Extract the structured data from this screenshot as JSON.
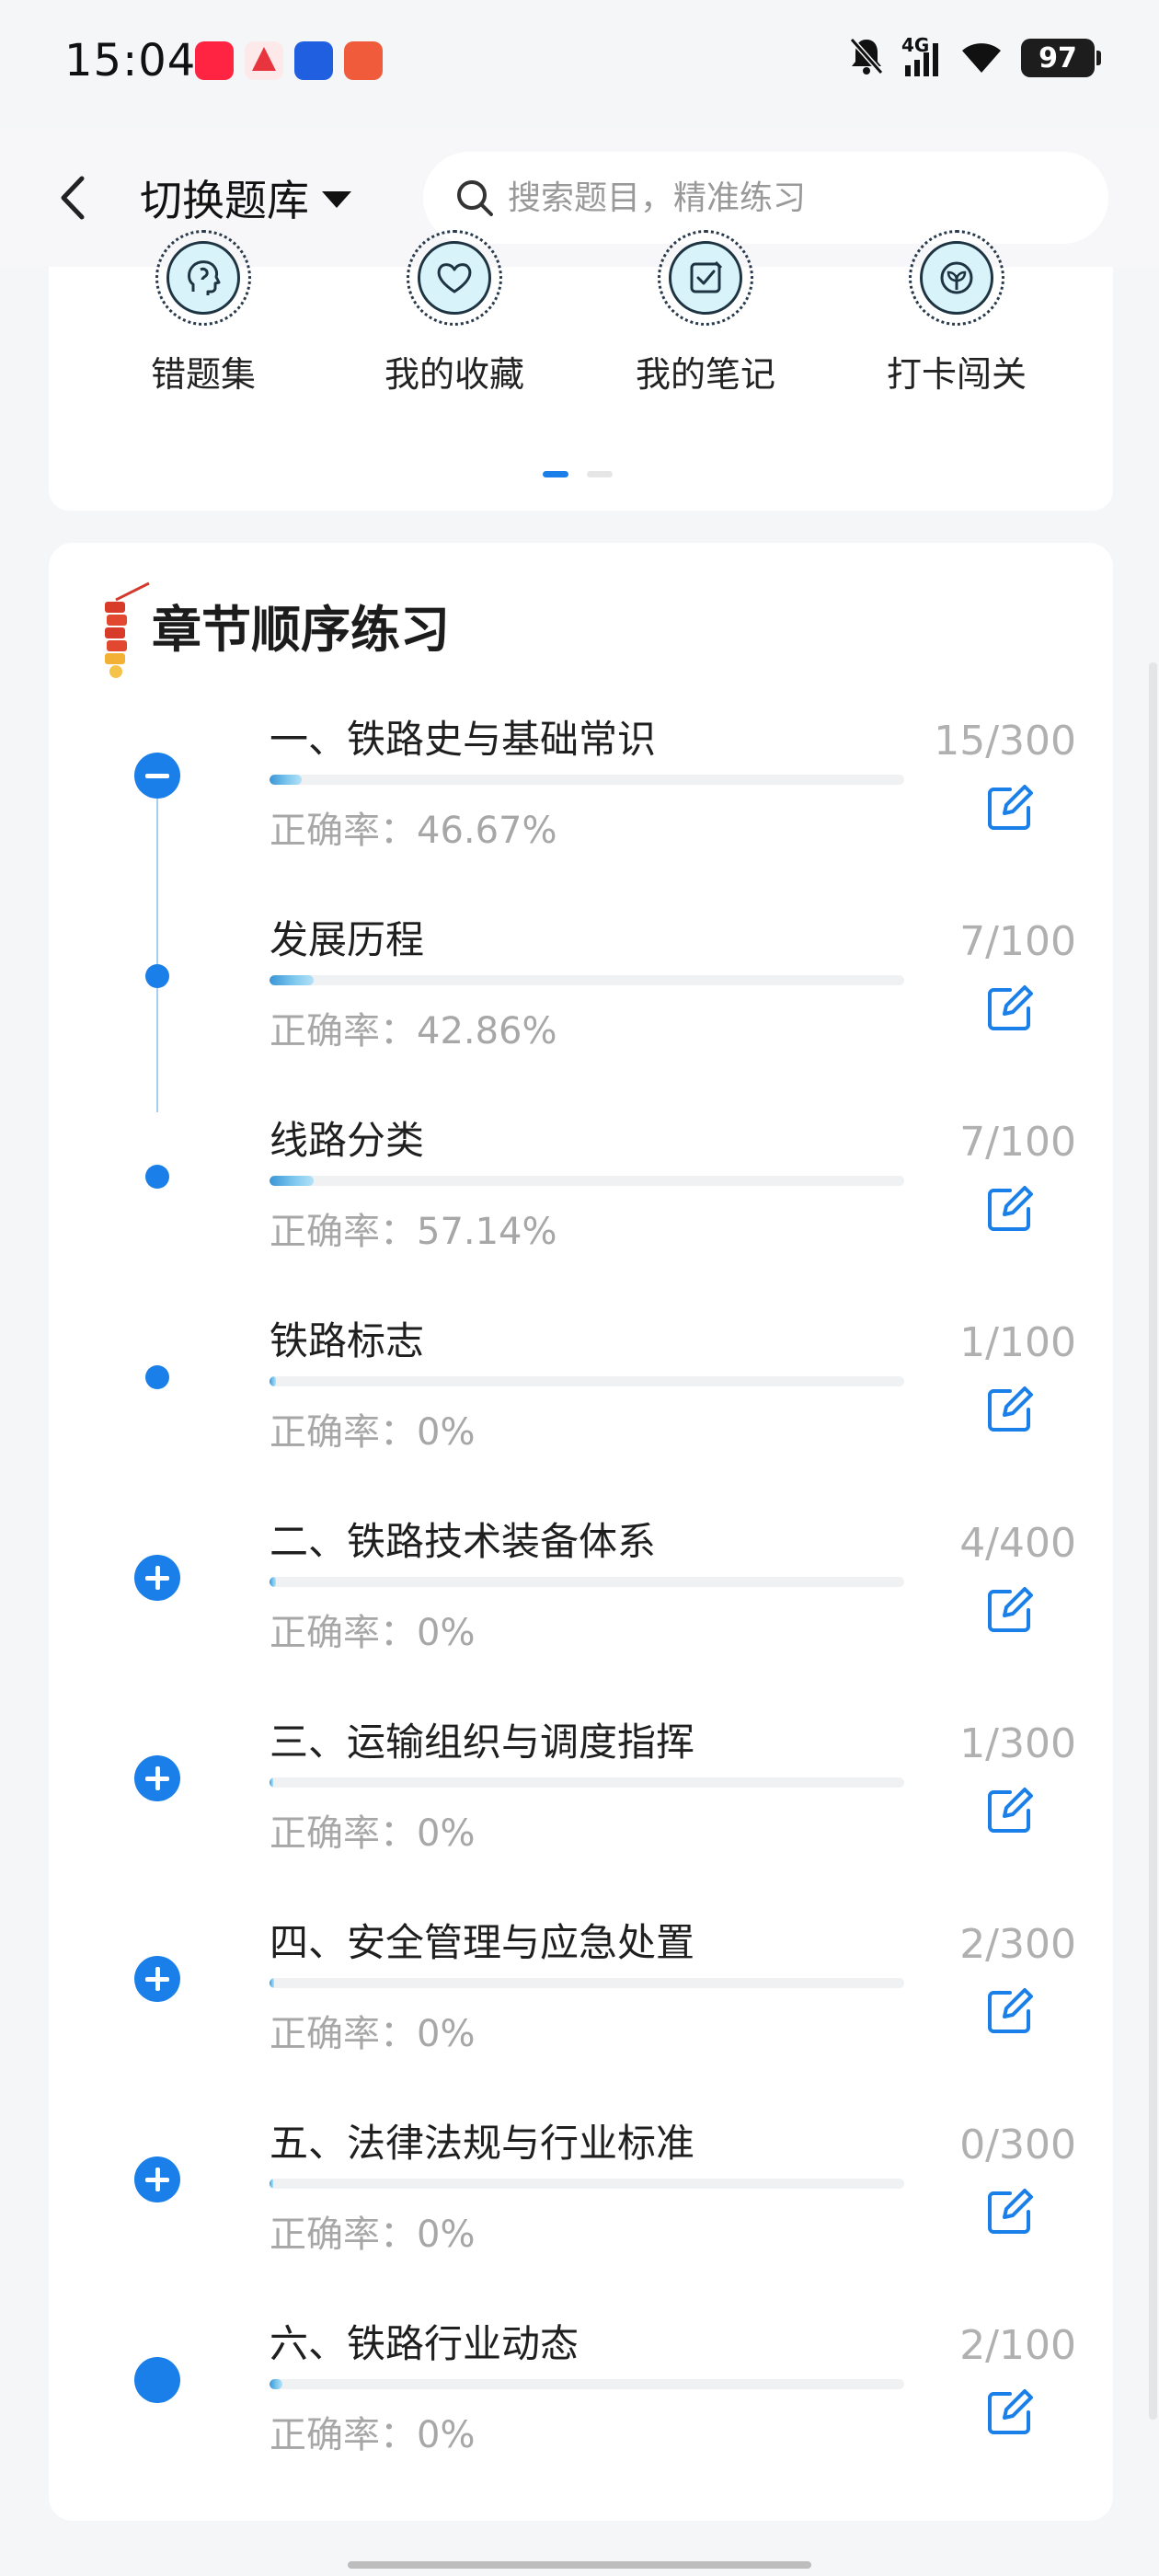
{
  "status_bar": {
    "time": "15:04",
    "network": "4G",
    "battery": "97",
    "app_icons": [
      "xiaohongshu-icon",
      "app-a-icon",
      "app-b-icon",
      "app-c-icon"
    ]
  },
  "header": {
    "switch_bank_label": "切换题库",
    "search_placeholder": "搜索题目，精准练习"
  },
  "quick_actions": [
    {
      "label": "错题集",
      "icon": "head-icon"
    },
    {
      "label": "我的收藏",
      "icon": "heart-icon"
    },
    {
      "label": "我的笔记",
      "icon": "note-check-icon"
    },
    {
      "label": "打卡闯关",
      "icon": "leaf-icon"
    }
  ],
  "chapter_section": {
    "title": "章节顺序练习",
    "chapters": [
      {
        "title": "一、铁路史与基础常识",
        "accuracy": "正确率：46.67%",
        "count": "15/300",
        "progress": 0.05,
        "marker": "minus"
      },
      {
        "title": "发展历程",
        "accuracy": "正确率：42.86%",
        "count": "7/100",
        "progress": 0.07,
        "marker": "dot"
      },
      {
        "title": "线路分类",
        "accuracy": "正确率：57.14%",
        "count": "7/100",
        "progress": 0.07,
        "marker": "dot"
      },
      {
        "title": "铁路标志",
        "accuracy": "正确率：0%",
        "count": "1/100",
        "progress": 0.01,
        "marker": "dot"
      },
      {
        "title": "二、铁路技术装备体系",
        "accuracy": "正确率：0%",
        "count": "4/400",
        "progress": 0.01,
        "marker": "plus"
      },
      {
        "title": "三、运输组织与调度指挥",
        "accuracy": "正确率：0%",
        "count": "1/300",
        "progress": 0.003,
        "marker": "plus"
      },
      {
        "title": "四、安全管理与应急处置",
        "accuracy": "正确率：0%",
        "count": "2/300",
        "progress": 0.007,
        "marker": "plus"
      },
      {
        "title": "五、法律法规与行业标准",
        "accuracy": "正确率：0%",
        "count": "0/300",
        "progress": 0.0,
        "marker": "plus"
      },
      {
        "title": "六、铁路行业动态",
        "accuracy": "正确率：0%",
        "count": "2/100",
        "progress": 0.02,
        "marker": "big-dot"
      }
    ]
  },
  "colors": {
    "accent": "#1a7fe8",
    "muted_text": "#a7a7a7",
    "background": "#f5f6f8"
  }
}
